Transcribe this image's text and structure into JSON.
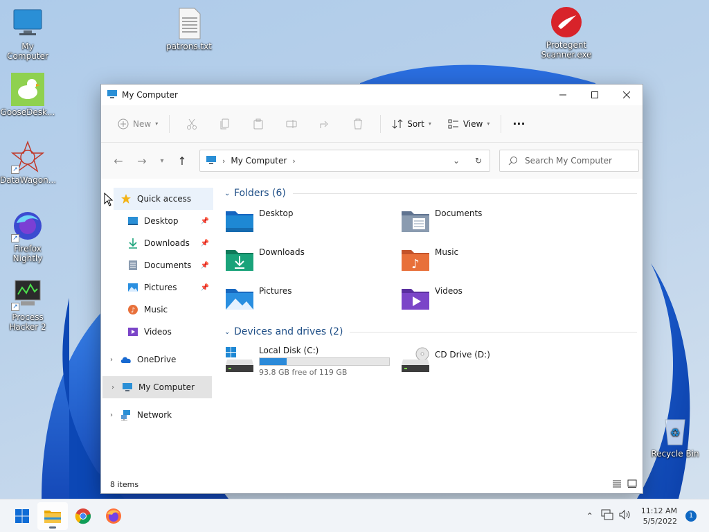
{
  "desktop": {
    "icons": [
      {
        "label": "My Computer"
      },
      {
        "label": "patrons.txt"
      },
      {
        "label": "Protegent Scanner.exe"
      },
      {
        "label": "GooseDesk..."
      },
      {
        "label": "DataWagon..."
      },
      {
        "label": "Firefox Nightly"
      },
      {
        "label": "Process Hacker 2"
      },
      {
        "label": "Recycle Bin"
      }
    ]
  },
  "window": {
    "title": "My Computer",
    "controls": {
      "minimize": "minimize",
      "maximize": "maximize",
      "close": "close"
    }
  },
  "commandbar": {
    "new_label": "New",
    "sort_label": "Sort",
    "view_label": "View",
    "more_label": "···"
  },
  "navbar": {
    "breadcrumb": "My Computer",
    "search_placeholder": "Search My Computer"
  },
  "navpane": {
    "quick_access": "Quick access",
    "pinned": [
      {
        "label": "Desktop",
        "icon": "desktop-icon"
      },
      {
        "label": "Downloads",
        "icon": "download-icon"
      },
      {
        "label": "Documents",
        "icon": "documents-icon"
      },
      {
        "label": "Pictures",
        "icon": "pictures-icon"
      },
      {
        "label": "Music",
        "icon": "music-icon"
      },
      {
        "label": "Videos",
        "icon": "videos-icon"
      }
    ],
    "onedrive": "OneDrive",
    "my_computer": "My Computer",
    "network": "Network"
  },
  "content": {
    "folders_heading": "Folders (6)",
    "folders": [
      {
        "label": "Desktop",
        "color": "#1e88d4"
      },
      {
        "label": "Documents",
        "color": "#7f93ad"
      },
      {
        "label": "Downloads",
        "color": "#1aa37a"
      },
      {
        "label": "Music",
        "color": "#e8703a"
      },
      {
        "label": "Pictures",
        "color": "#2a8fe0"
      },
      {
        "label": "Videos",
        "color": "#7b45c8"
      }
    ],
    "drives_heading": "Devices and drives (2)",
    "drives": [
      {
        "label": "Local Disk (C:)",
        "free_text": "93.8 GB free of 119 GB",
        "used_fraction": 0.21
      },
      {
        "label": "CD Drive (D:)"
      }
    ]
  },
  "statusbar": {
    "items_text": "8 items"
  },
  "taskbar": {
    "time": "11:12 AM",
    "date": "5/5/2022",
    "notification_count": "1"
  },
  "colors": {
    "accent": "#2b8ad9",
    "heading": "#1e4e86"
  }
}
